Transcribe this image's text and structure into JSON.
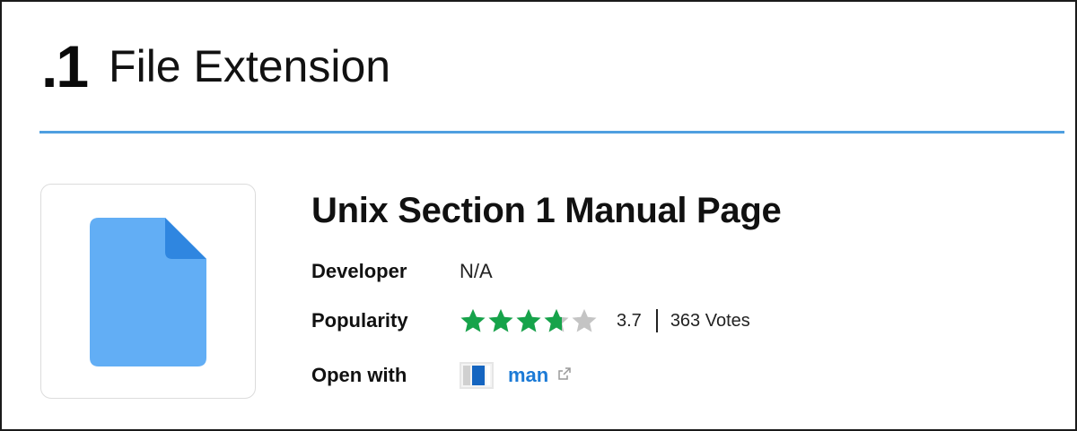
{
  "header": {
    "extension": ".1",
    "title": "File Extension"
  },
  "file_type": {
    "name": "Unix Section 1 Manual Page",
    "icon": "document-icon"
  },
  "details": {
    "developer_label": "Developer",
    "developer_value": "N/A",
    "popularity_label": "Popularity",
    "rating": 3.7,
    "rating_text": "3.7",
    "rating_max": 5,
    "votes_text": "363 Votes",
    "open_with_label": "Open with",
    "app_name": "man",
    "app_icon": "man-app-icon"
  },
  "colors": {
    "accent_divider": "#4f9fe0",
    "star_fill": "#16a34a",
    "star_empty": "#c4c4c4",
    "link": "#1b7ad6",
    "file_icon_body": "#62aef5",
    "file_icon_fold": "#2f86e0"
  }
}
